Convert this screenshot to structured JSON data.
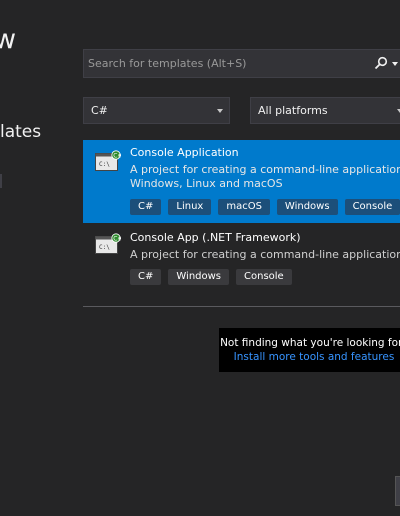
{
  "header": {
    "partial_title": "w",
    "partial_subtitle": "lates"
  },
  "search": {
    "placeholder": "Search for templates (Alt+S)"
  },
  "filters": {
    "language": "C#",
    "platform": "All platforms"
  },
  "templates": [
    {
      "name": "Console Application",
      "description_line1": "A project for creating a command-line application that ca",
      "description_line2": "Windows, Linux and macOS",
      "tags": [
        "C#",
        "Linux",
        "macOS",
        "Windows",
        "Console"
      ],
      "selected": true
    },
    {
      "name": "Console App (.NET Framework)",
      "description_line1": "A project for creating a command-line application",
      "tags": [
        "C#",
        "Windows",
        "Console"
      ],
      "selected": false
    }
  ],
  "not_finding": {
    "text": "Not finding what you're looking for?",
    "link": "Install more tools and features"
  },
  "colors": {
    "background": "#252526",
    "selection": "#007acc",
    "link": "#3794ff"
  },
  "icons": [
    "search-icon",
    "chevron-down-icon",
    "console-app-icon"
  ]
}
